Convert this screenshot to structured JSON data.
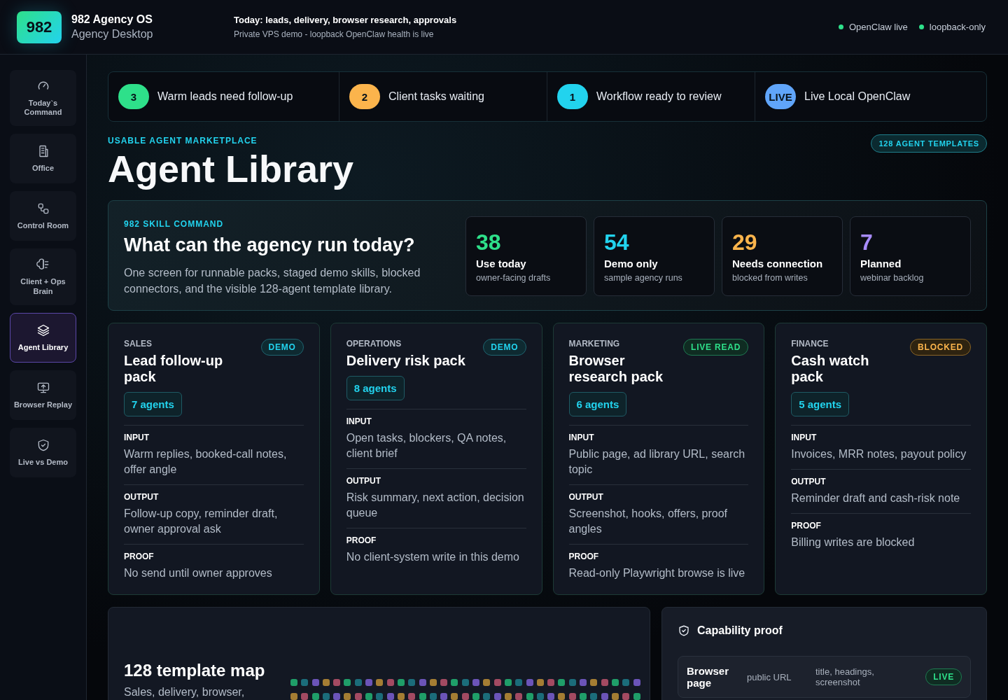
{
  "brand": {
    "logo": "982",
    "title": "982 Agency OS",
    "subtitle": "Agency Desktop"
  },
  "header": {
    "headline": "Today: leads, delivery, browser research, approvals",
    "subline": "Private VPS demo - loopback OpenClaw health is live",
    "statuses": [
      {
        "label": "OpenClaw live",
        "color": "#2ee08a"
      },
      {
        "label": "loopback-only",
        "color": "#2ee08a"
      }
    ]
  },
  "sidebar": {
    "items": [
      {
        "label": "Today`s Command",
        "selected": false
      },
      {
        "label": "Office",
        "selected": false
      },
      {
        "label": "Control Room",
        "selected": false
      },
      {
        "label": "Client + Ops Brain",
        "selected": false
      },
      {
        "label": "Agent Library",
        "selected": true
      },
      {
        "label": "Browser Replay",
        "selected": false
      },
      {
        "label": "Live vs Demo",
        "selected": false
      }
    ]
  },
  "alerts": [
    {
      "badge": "3",
      "label": "Warm leads need follow-up",
      "color": "#2ee08a"
    },
    {
      "badge": "2",
      "label": "Client tasks waiting",
      "color": "#fbb44c"
    },
    {
      "badge": "1",
      "label": "Workflow ready to review",
      "color": "#22d3ee"
    },
    {
      "badge": "LIVE",
      "label": "Live Local OpenClaw",
      "color": "#60a5fa"
    }
  ],
  "page": {
    "eyebrow": "USABLE AGENT MARKETPLACE",
    "title": "Agent Library",
    "templates_badge": "128 AGENT TEMPLATES"
  },
  "skill_command": {
    "eyebrow": "982 SKILL COMMAND",
    "title": "What can the agency run today?",
    "text": "One screen for runnable packs, staged demo skills, blocked connectors, and the visible 128-agent template library.",
    "stats": [
      {
        "value": "38",
        "label": "Use today",
        "note": "owner-facing drafts",
        "color": "#2ee08a"
      },
      {
        "value": "54",
        "label": "Demo only",
        "note": "sample agency runs",
        "color": "#22d3ee"
      },
      {
        "value": "29",
        "label": "Needs connection",
        "note": "blocked from writes",
        "color": "#fbb44c"
      },
      {
        "value": "7",
        "label": "Planned",
        "note": "webinar backlog",
        "color": "#a78bfa"
      }
    ]
  },
  "packs": [
    {
      "category": "SALES",
      "title": "Lead follow-up pack",
      "status": "DEMO",
      "kind": "demo",
      "agents": "7 agents",
      "sections": [
        {
          "label": "INPUT",
          "text": "Warm replies, booked-call notes, offer angle"
        },
        {
          "label": "OUTPUT",
          "text": "Follow-up copy, reminder draft, owner approval ask"
        },
        {
          "label": "PROOF",
          "text": "No send until owner approves"
        }
      ]
    },
    {
      "category": "OPERATIONS",
      "title": "Delivery risk pack",
      "status": "DEMO",
      "kind": "demo",
      "agents": "8 agents",
      "sections": [
        {
          "label": "INPUT",
          "text": "Open tasks, blockers, QA notes, client brief"
        },
        {
          "label": "OUTPUT",
          "text": "Risk summary, next action, decision queue"
        },
        {
          "label": "PROOF",
          "text": "No client-system write in this demo"
        }
      ]
    },
    {
      "category": "MARKETING",
      "title": "Browser research pack",
      "status": "LIVE READ",
      "kind": "live",
      "agents": "6 agents",
      "sections": [
        {
          "label": "INPUT",
          "text": "Public page, ad library URL, search topic"
        },
        {
          "label": "OUTPUT",
          "text": "Screenshot, hooks, offers, proof angles"
        },
        {
          "label": "PROOF",
          "text": "Read-only Playwright browse is live"
        }
      ]
    },
    {
      "category": "FINANCE",
      "title": "Cash watch pack",
      "status": "BLOCKED",
      "kind": "blocked",
      "agents": "5 agents",
      "sections": [
        {
          "label": "INPUT",
          "text": "Invoices, MRR notes, payout policy"
        },
        {
          "label": "OUTPUT",
          "text": "Reminder draft and cash-risk note"
        },
        {
          "label": "PROOF",
          "text": "Billing writes are blocked"
        }
      ]
    }
  ],
  "template_map": {
    "title": "128 template map",
    "text": "Sales, delivery, browser,"
  },
  "capability_proof": {
    "title": "Capability proof",
    "rows": [
      {
        "name": "Browser page",
        "input": "public URL",
        "output": "title, headings, screenshot",
        "status": "LIVE",
        "kind": "live"
      }
    ]
  }
}
